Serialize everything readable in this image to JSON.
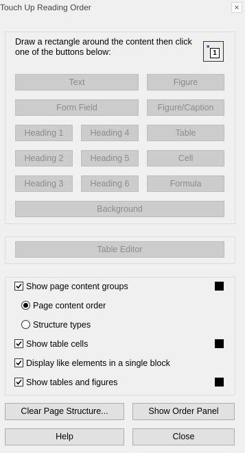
{
  "window": {
    "title": "Touch Up Reading Order",
    "close_glyph": "✕"
  },
  "instructions": "Draw a rectangle around the content then click one of the buttons below:",
  "tag_buttons": {
    "text": "Text",
    "figure": "Figure",
    "form_field": "Form Field",
    "figure_caption": "Figure/Caption",
    "heading1": "Heading 1",
    "heading4": "Heading 4",
    "table": "Table",
    "heading2": "Heading 2",
    "heading5": "Heading 5",
    "cell": "Cell",
    "heading3": "Heading 3",
    "heading6": "Heading 6",
    "formula": "Formula",
    "background": "Background"
  },
  "table_editor": "Table Editor",
  "options": {
    "show_page_content_groups": {
      "label": "Show page content groups",
      "checked": true
    },
    "page_content_order": {
      "label": "Page content order",
      "selected": true
    },
    "structure_types": {
      "label": "Structure types",
      "selected": false
    },
    "show_table_cells": {
      "label": "Show table cells",
      "checked": true
    },
    "display_like_elements": {
      "label": "Display like elements in a single block",
      "checked": true
    },
    "show_tables_and_figures": {
      "label": "Show tables and figures",
      "checked": true
    }
  },
  "swatch_color": "#000000",
  "buttons": {
    "clear_page_structure": "Clear Page Structure...",
    "show_order_panel": "Show Order Panel",
    "help": "Help",
    "close": "Close"
  }
}
